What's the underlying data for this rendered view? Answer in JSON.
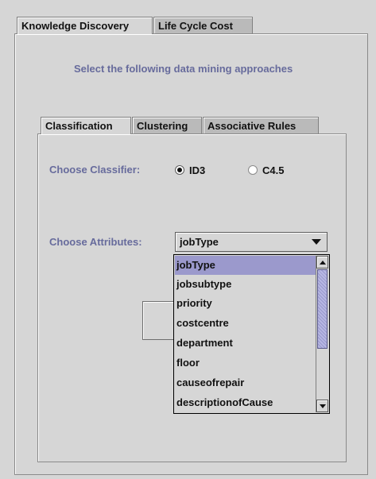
{
  "tabs": [
    {
      "label": "Knowledge Discovery",
      "selected": true
    },
    {
      "label": "Life Cycle Cost",
      "selected": false
    }
  ],
  "heading": "Select the following data mining approaches",
  "subtabs": [
    {
      "label": "Classification",
      "selected": true
    },
    {
      "label": "Clustering",
      "selected": false
    },
    {
      "label": "Associative Rules",
      "selected": false
    }
  ],
  "classifier": {
    "label": "Choose Classifier:",
    "options": [
      {
        "label": "ID3",
        "checked": true
      },
      {
        "label": "C4.5",
        "checked": false
      }
    ]
  },
  "attributes": {
    "label": "Choose Attributes:",
    "selected": "jobType",
    "options": [
      "jobType",
      "jobsubtype",
      "priority",
      "costcentre",
      "department",
      "floor",
      "causeofrepair",
      "descriptionofCause"
    ]
  },
  "colors": {
    "label_text": "#676b9c",
    "selection": "#9b99cc",
    "panel": "#d6d6d6"
  }
}
